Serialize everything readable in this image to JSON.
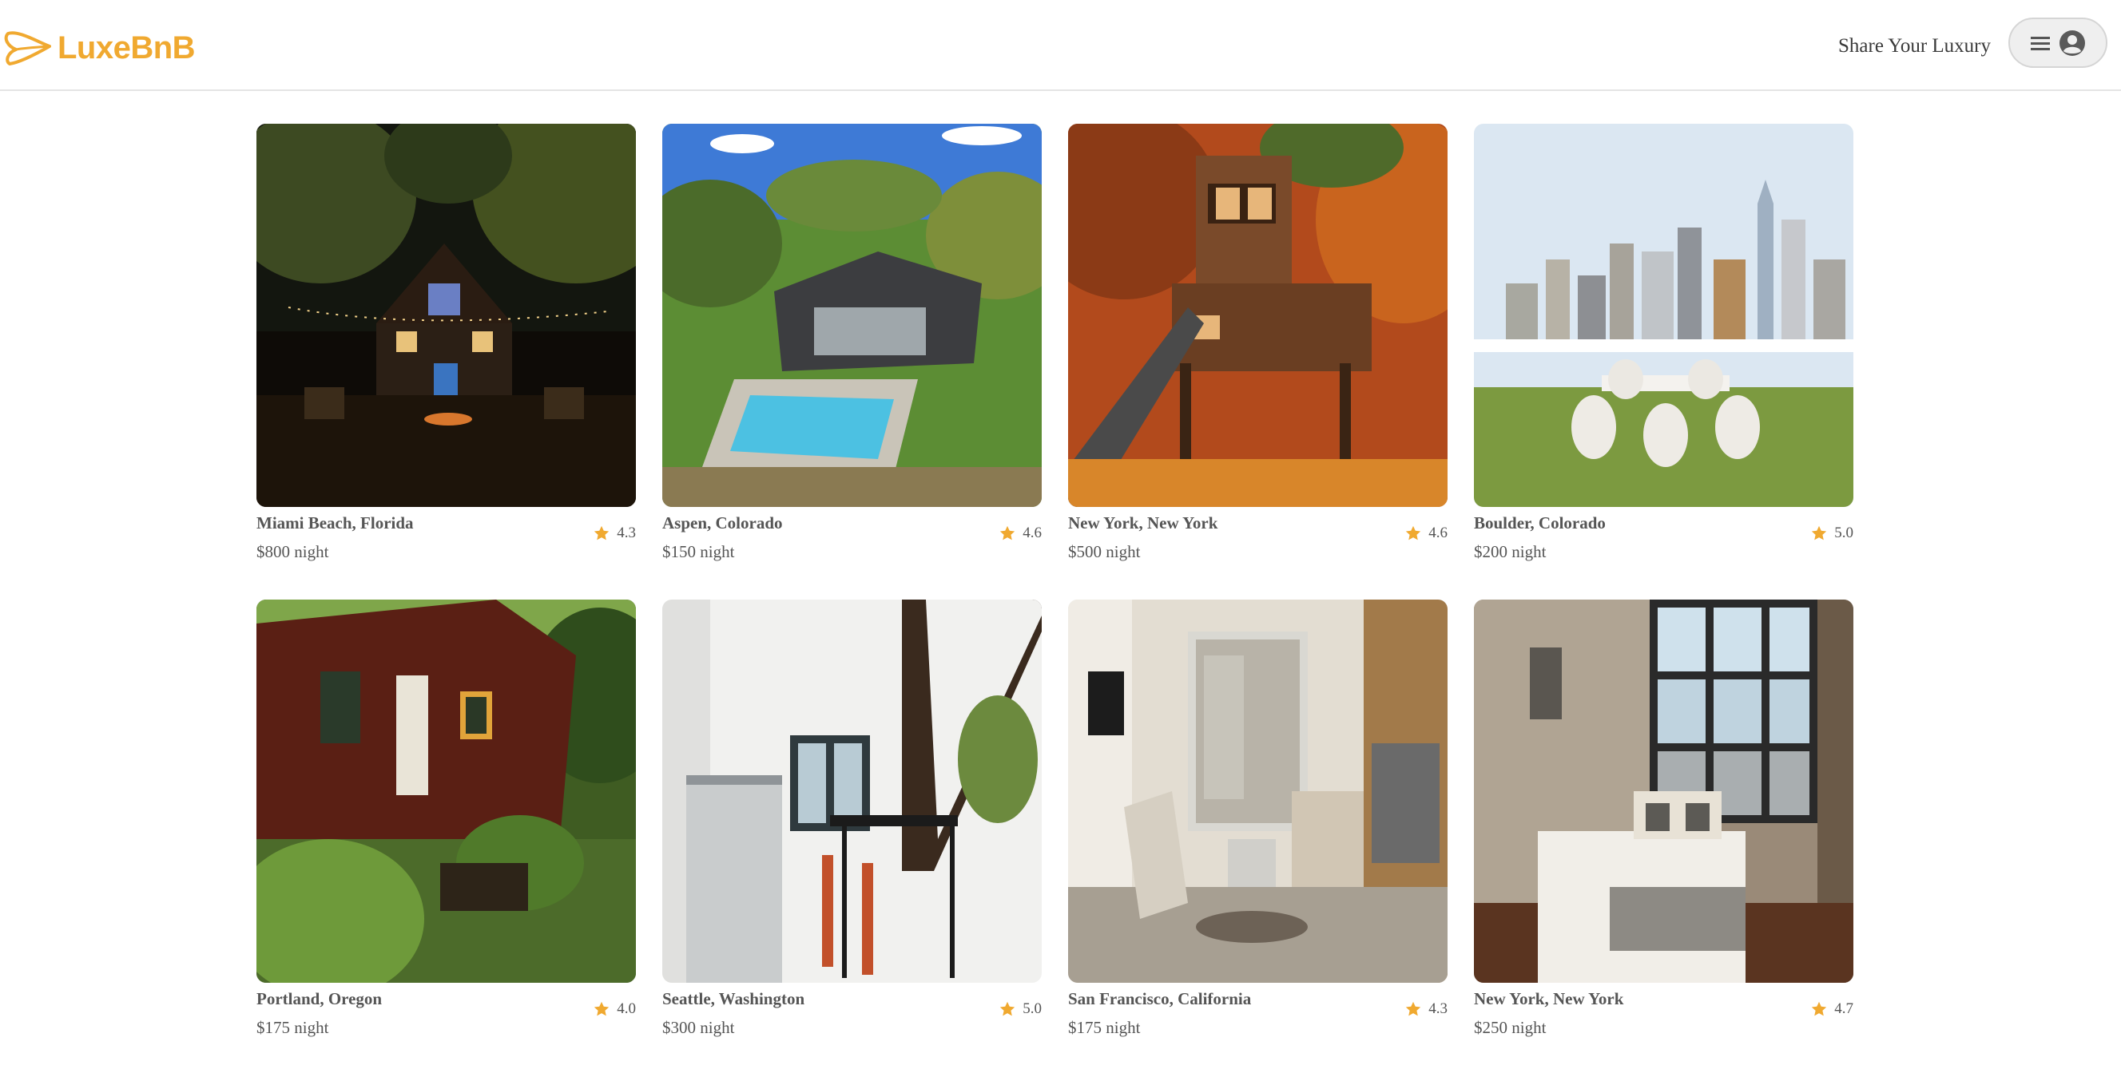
{
  "app": {
    "name": "LuxeBnB",
    "brand_color": "#f0a930"
  },
  "header": {
    "host_link": "Share Your Luxury",
    "menu_icon": "hamburger-icon",
    "avatar_icon": "user-avatar-icon"
  },
  "listings": [
    {
      "location": "Miami Beach, Florida",
      "price": "$800 night",
      "rating": "4.3",
      "photo": "cabin-night"
    },
    {
      "location": "Aspen, Colorado",
      "price": "$150 night",
      "rating": "4.6",
      "photo": "modern-house-pool"
    },
    {
      "location": "New York, New York",
      "price": "$500 night",
      "rating": "4.6",
      "photo": "treehouse"
    },
    {
      "location": "Boulder, Colorado",
      "price": "$200 night",
      "rating": "5.0",
      "photo": "skyline-terrace"
    },
    {
      "location": "Portland, Oregon",
      "price": "$175 night",
      "rating": "4.0",
      "photo": "red-cabin-garden"
    },
    {
      "location": "Seattle, Washington",
      "price": "$300 night",
      "rating": "5.0",
      "photo": "loft-kitchen"
    },
    {
      "location": "San Francisco, California",
      "price": "$175 night",
      "rating": "4.3",
      "photo": "studio-apartment"
    },
    {
      "location": "New York, New York",
      "price": "$250 night",
      "rating": "4.7",
      "photo": "loft-bedroom"
    }
  ],
  "star_color": "#f0a930"
}
